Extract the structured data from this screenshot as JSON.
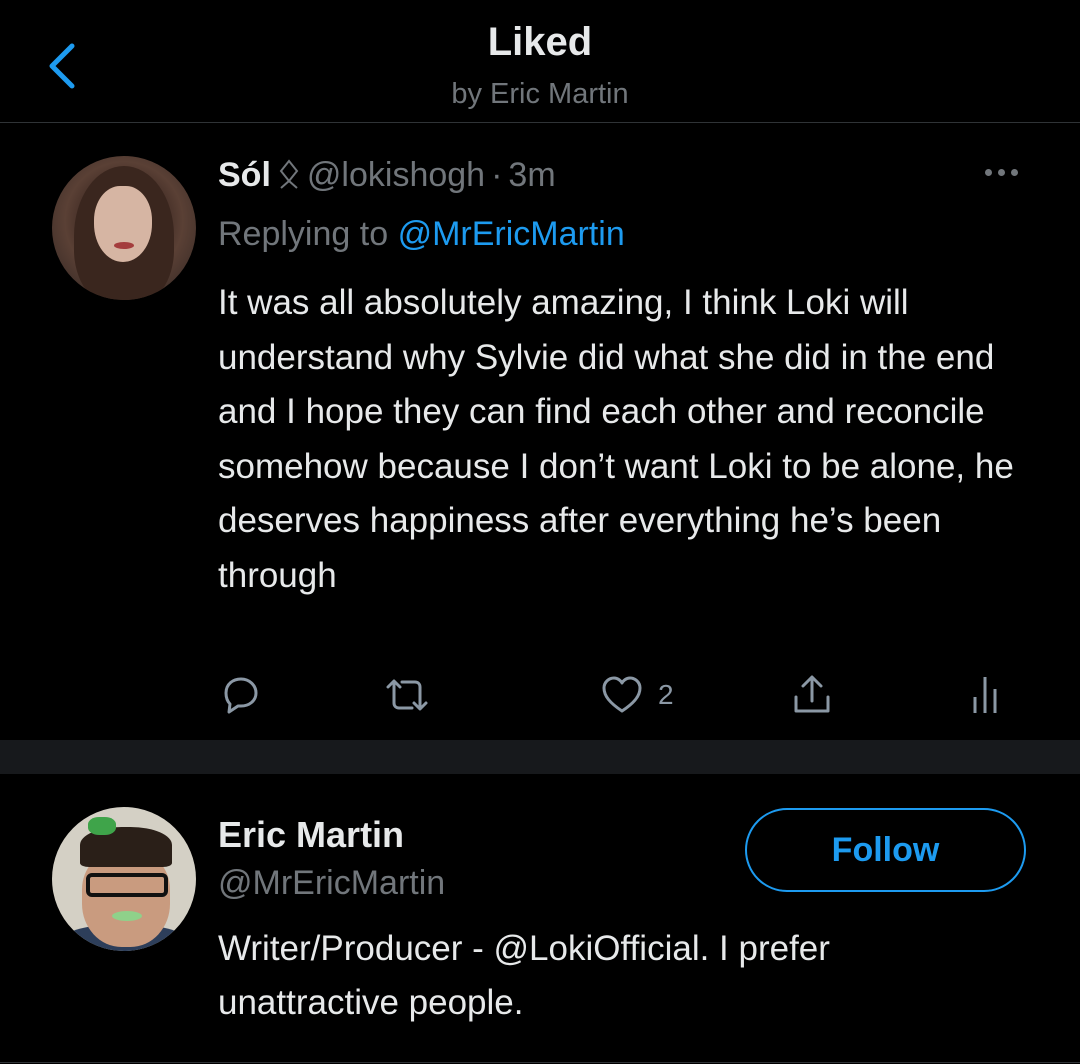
{
  "header": {
    "title": "Liked",
    "subtitle": "by Eric Martin"
  },
  "tweet": {
    "author_name": "Sól",
    "author_handle": "@lokishogh",
    "separator": "·",
    "time": "3m",
    "replying_prefix": "Replying to",
    "replying_to": "@MrEricMartin",
    "text": "It was all absolutely amazing, I think Loki will understand why Sylvie did what she did in the end and I hope they can find each other and reconcile somehow because I don’t want Loki to be alone, he deserves happiness after everything he’s been through",
    "like_count": "2"
  },
  "user_card": {
    "name": "Eric Martin",
    "handle": "@MrEricMartin",
    "bio": "Writer/Producer - @LokiOfficial. I prefer unattractive people.",
    "follow_label": "Follow"
  },
  "colors": {
    "background": "#000000",
    "accent": "#1d9bf0",
    "muted": "#71767b",
    "text": "#e7e9ea",
    "divider_band": "#17191c"
  },
  "icons": [
    "back-chevron-icon",
    "rune-badge-icon",
    "more-icon",
    "reply-icon",
    "retweet-icon",
    "like-icon",
    "share-icon",
    "analytics-icon"
  ]
}
